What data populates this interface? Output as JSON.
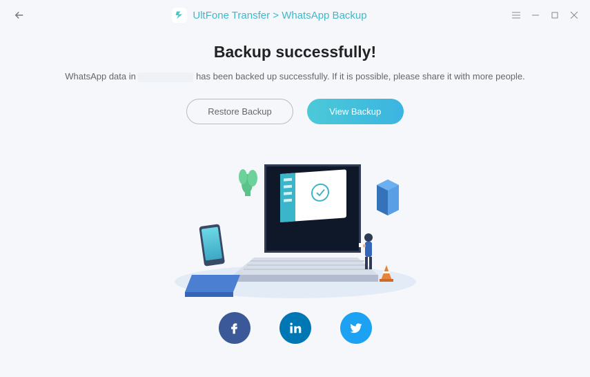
{
  "titlebar": {
    "breadcrumb": "UltFone Transfer > WhatsApp Backup"
  },
  "main": {
    "headline": "Backup successfully!",
    "subtext_prefix": "WhatsApp data in ",
    "subtext_suffix": " has been backed up successfully. If it is possible, please share it with more people.",
    "restore_label": "Restore Backup",
    "view_label": "View Backup"
  },
  "social": {
    "facebook": "facebook",
    "linkedin": "linkedin",
    "twitter": "twitter"
  }
}
